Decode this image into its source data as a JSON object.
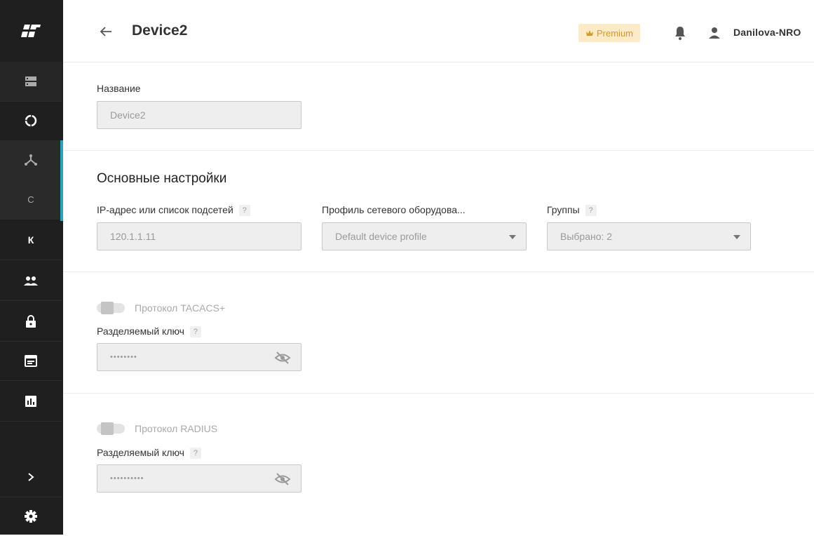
{
  "sidebar": {
    "items": [
      {
        "icon": "logo-icon"
      },
      {
        "icon": "storage-icon"
      },
      {
        "icon": "circle-loop-icon"
      },
      {
        "icon": "network-tree-icon"
      },
      {
        "label": "C"
      },
      {
        "label": "К"
      },
      {
        "icon": "people-icon"
      },
      {
        "icon": "lock-icon"
      },
      {
        "icon": "calendar-icon"
      },
      {
        "icon": "bar-chart-icon"
      },
      {
        "icon": "chevron-right-icon"
      },
      {
        "icon": "gear-icon"
      }
    ]
  },
  "header": {
    "title": "Device2",
    "premium_label": "Premium",
    "user_name": "Danilova-NRO"
  },
  "form": {
    "name_label": "Название",
    "name_value": "Device2",
    "main_settings_title": "Основные настройки",
    "ip_label": "IP-адрес или список подсетей",
    "ip_value": "120.1.1.11",
    "profile_label": "Профиль сетевого оборудова...",
    "profile_value": "Default device profile",
    "groups_label": "Группы",
    "groups_value": "Выбрано: 2",
    "help_mark": "?",
    "tacacs_label": "Протокол TACACS+",
    "tacacs_key_label": "Разделяемый ключ",
    "tacacs_key_value": "••••••••",
    "radius_label": "Протокол RADIUS",
    "radius_key_label": "Разделяемый ключ",
    "radius_key_value": "••••••••••"
  },
  "colors": {
    "sidebar_bg": "#1f1f1f",
    "accent": "#2aa3c0",
    "premium_bg": "#fdebc8",
    "premium_text": "#d39a2b"
  }
}
